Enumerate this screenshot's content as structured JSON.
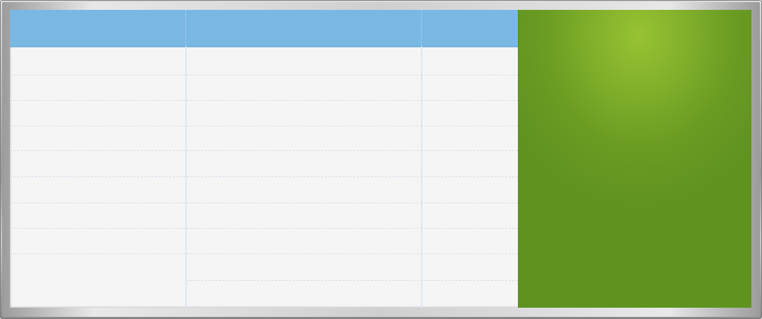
{
  "table": {
    "headers": [
      "",
      "",
      ""
    ],
    "rows": [
      [
        "",
        "",
        ""
      ],
      [
        "",
        "",
        ""
      ],
      [
        "",
        "",
        ""
      ],
      [
        "",
        "",
        ""
      ],
      [
        "",
        "",
        ""
      ],
      [
        "",
        "",
        ""
      ],
      [
        "",
        "",
        ""
      ],
      [
        "",
        "",
        ""
      ],
      [
        "",
        "",
        ""
      ]
    ]
  },
  "colors": {
    "header": "#7ab8e4",
    "board_background": "#f6f5f6",
    "side_panel": "#6a9b22",
    "side_panel_highlight": "#97c232",
    "frame": "#b9b9b9"
  }
}
